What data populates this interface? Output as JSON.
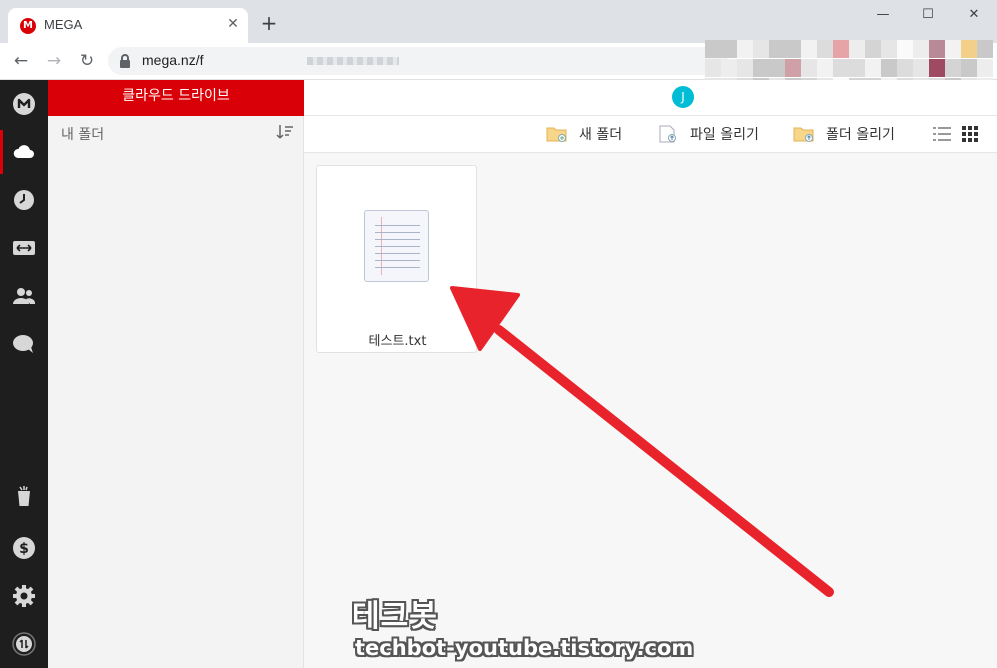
{
  "browser": {
    "tab_title": "MEGA",
    "tab_favicon": "M",
    "tab_close": "✕",
    "new_tab": "+",
    "url": "mega.nz/f",
    "window_controls": {
      "minimize": "—",
      "maximize": "☐",
      "close": "✕"
    },
    "nav": {
      "back": "←",
      "forward": "→",
      "reload": "↻"
    }
  },
  "rail": {
    "items": [
      {
        "icon": "mega-logo-icon"
      },
      {
        "icon": "cloud-drive-icon",
        "active": true
      },
      {
        "icon": "recents-clock-icon"
      },
      {
        "icon": "transfers-icon"
      },
      {
        "icon": "contacts-icon"
      },
      {
        "icon": "chat-icon"
      },
      {
        "icon": "rubbish-bin-icon"
      },
      {
        "icon": "upgrade-dollar-icon"
      },
      {
        "icon": "settings-gear-icon"
      },
      {
        "icon": "transfer-status-icon"
      }
    ]
  },
  "panel": {
    "header": "클라우드 드라이브",
    "title": "내 폴더"
  },
  "topbar": {
    "avatar_letter": "J"
  },
  "actions": {
    "new_folder": "새 폴더",
    "upload_file": "파일 올리기",
    "upload_folder": "폴더 올리기"
  },
  "files": [
    {
      "name": "테스트.txt",
      "type": "text-document"
    }
  ],
  "watermark": {
    "title": "테크봇",
    "url": "techbot-youtube.tistory.com"
  },
  "colors": {
    "brand_red": "#d90007",
    "rail_bg": "#1e1e1e",
    "arrow_red": "#e8232b",
    "avatar": "#00bcd4"
  }
}
